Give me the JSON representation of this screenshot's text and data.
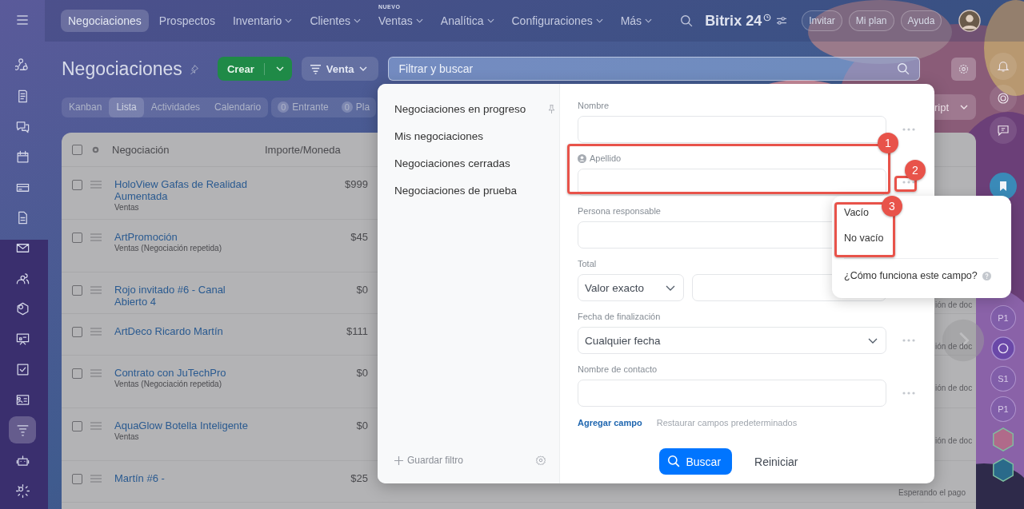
{
  "top_nav": {
    "items": [
      {
        "label": "Negociaciones",
        "selected": true,
        "dropdown": false
      },
      {
        "label": "Prospectos",
        "selected": false,
        "dropdown": false
      },
      {
        "label": "Inventario",
        "selected": false,
        "dropdown": true
      },
      {
        "label": "Clientes",
        "selected": false,
        "dropdown": true
      },
      {
        "label": "Ventas",
        "selected": false,
        "dropdown": true,
        "badge": "NUEVO"
      },
      {
        "label": "Analítica",
        "selected": false,
        "dropdown": true
      },
      {
        "label": "Configuraciones",
        "selected": false,
        "dropdown": true
      },
      {
        "label": "Más",
        "selected": false,
        "dropdown": true
      }
    ],
    "brand": "Bitrix 24",
    "buttons": [
      "Invitar",
      "Mi plan",
      "Ayuda"
    ]
  },
  "sidebar": {
    "items": [
      {
        "selected": false
      },
      {
        "selected": false
      },
      {
        "selected": false
      },
      {
        "selected": false
      },
      {
        "selected": false
      },
      {
        "selected": false
      },
      {
        "selected": false
      },
      {
        "selected": false
      },
      {
        "selected": false
      },
      {
        "selected": false
      },
      {
        "selected": false
      },
      {
        "selected": false
      },
      {
        "selected": true
      },
      {
        "selected": false
      },
      {
        "selected": false
      }
    ]
  },
  "header": {
    "title": "Negociaciones",
    "create_button": "Crear",
    "pipeline": "Venta",
    "search_placeholder": "Filtrar y buscar"
  },
  "view_tabs": [
    {
      "label": "Kanban",
      "selected": false
    },
    {
      "label": "Lista",
      "selected": true
    },
    {
      "label": "Actividades",
      "selected": false
    },
    {
      "label": "Calendario",
      "selected": false
    }
  ],
  "counters": [
    {
      "count": "0",
      "label": "Entrante"
    },
    {
      "count": "0",
      "label": "Pla"
    }
  ],
  "cut_button": "ript",
  "table": {
    "columns": [
      "Negociación",
      "Importe/Moneda"
    ],
    "all_checked": false,
    "rows": [
      {
        "checked": false,
        "title": "HoloView Gafas de Realidad Aumentada",
        "subtitle": "Ventas",
        "amount": "$999"
      },
      {
        "checked": false,
        "title": "ArtPromoción",
        "subtitle": "Ventas (Negociación repetida)",
        "amount": "$45"
      },
      {
        "checked": false,
        "title": "Rojo invitado #6 - Canal Abierto 4",
        "amount": "$0",
        "column_3": "ión de doc"
      },
      {
        "checked": false,
        "title": "ArtDeco Ricardo Martín",
        "amount": "$111",
        "column_3": "ión de doc"
      },
      {
        "checked": false,
        "title": "Contrato con JuTechPro",
        "subtitle": "Ventas (Negociación repetida)",
        "amount": "$0",
        "column_3": "ión de doc"
      },
      {
        "checked": false,
        "title": "AquaGlow Botella Inteligente",
        "subtitle": "Ventas",
        "amount": "$0",
        "column_3": "ión de doc"
      },
      {
        "checked": false,
        "title": "Martín #6 -",
        "amount": "$25",
        "column_3": "Esperando el pago"
      }
    ]
  },
  "right_rail": {
    "avatars": [
      "P1",
      "S1",
      "P1"
    ]
  },
  "filter_panel": {
    "presets": [
      {
        "label": "Negociaciones en progreso",
        "pinned": true
      },
      {
        "label": "Mis negociaciones",
        "pinned": false
      },
      {
        "label": "Negociaciones cerradas",
        "pinned": false
      },
      {
        "label": "Negociaciones de prueba",
        "pinned": false
      }
    ],
    "save_filter": "Guardar filtro",
    "fields": [
      {
        "kind": "text",
        "label": "Nombre"
      },
      {
        "kind": "person",
        "label": "Apellido"
      },
      {
        "kind": "text",
        "label": "Persona responsable"
      },
      {
        "kind": "range",
        "label": "Total",
        "value": "Valor exacto"
      },
      {
        "kind": "select",
        "label": "Fecha de finalización",
        "value": "Cualquier fecha"
      },
      {
        "kind": "text",
        "label": "Nombre de contacto"
      }
    ],
    "add_field": "Agregar campo",
    "restore_fields": "Restaurar campos predeterminados",
    "search_button": "Buscar",
    "reset_button": "Reiniciar"
  },
  "field_menu": {
    "options": [
      "Vacío",
      "No vacío"
    ],
    "help": "¿Cómo funciona este campo?"
  },
  "annotations": [
    {
      "number": "1"
    },
    {
      "number": "2"
    },
    {
      "number": "3"
    }
  ]
}
